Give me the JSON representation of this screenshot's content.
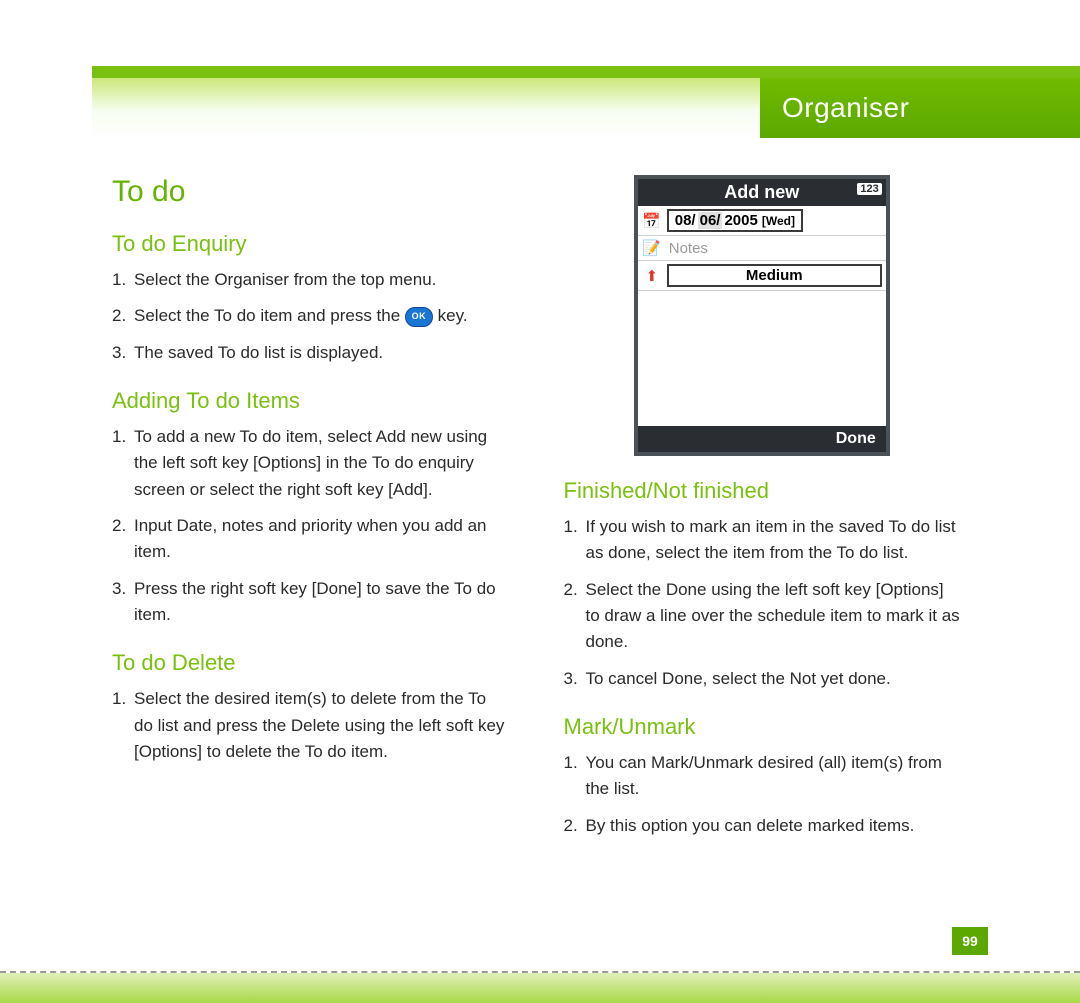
{
  "header": {
    "chapter_title": "Organiser"
  },
  "page_number": "99",
  "main_heading": "To do",
  "ok_key_label": "OK",
  "sections": {
    "enquiry": {
      "title": "To do Enquiry",
      "items": [
        "Select the Organiser from the top menu.",
        "Select the To do item and press the  key.",
        "The saved To do list is displayed."
      ],
      "ok_insert_index": 1
    },
    "adding": {
      "title": "Adding To do Items",
      "items": [
        "To add a new To do item, select Add new using the left soft key [Options] in the To do enquiry screen or select the right soft key [Add].",
        "Input Date, notes and priority when you add an item.",
        "Press the right soft key [Done] to save the To do item."
      ]
    },
    "delete": {
      "title": "To do Delete",
      "items": [
        "Select the desired item(s) to delete from the To do list and press the Delete using the left soft key [Options] to delete the To do item."
      ]
    },
    "finished": {
      "title": "Finished/Not finished",
      "items": [
        "If you wish to mark an item in the saved To do list as done, select the item from the To do list.",
        "Select the Done using the left soft key [Options] to draw a line over the schedule item to mark it as done.",
        "To cancel Done, select the Not yet done."
      ]
    },
    "mark": {
      "title": "Mark/Unmark",
      "items": [
        "You can Mark/Unmark desired (all) item(s) from the list.",
        "By this option you can delete marked items."
      ]
    }
  },
  "phone_screen": {
    "title": "Add new",
    "input_mode": "123",
    "date_prefix": "08/",
    "date_selected": "06/",
    "date_year": "2005",
    "day_label": "[Wed]",
    "notes_placeholder": "Notes",
    "priority": "Medium",
    "softkey_right": "Done"
  }
}
